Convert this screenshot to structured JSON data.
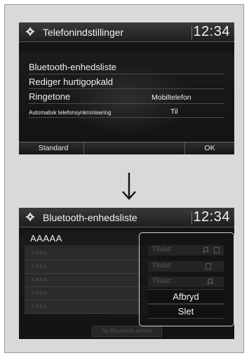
{
  "screen1": {
    "title": "Telefonindstillinger",
    "clock": "12:34",
    "menu": [
      {
        "label": "Bluetooth-enhedsliste",
        "value": ""
      },
      {
        "label": "Rediger hurtigopkald",
        "value": ""
      },
      {
        "label": "Ringetone",
        "value": "Mobiltelefon"
      },
      {
        "label": "Automatisk telefonsynkronisering",
        "value": "Til"
      }
    ],
    "buttons": {
      "left": "Standard",
      "right": "OK"
    }
  },
  "arrow": "↓",
  "screen2": {
    "title": "Bluetooth-enhedsliste",
    "clock": "12:34",
    "devices": [
      "AAAAA",
      "<xxx",
      "<xxx",
      "<xxx",
      "<xxx",
      "<xxx"
    ],
    "bottom_hint": "Ny Bluetooth-enhed",
    "popup": {
      "connect_items": [
        "Tilslut:",
        "Tilslut:",
        "Tilslut:"
      ],
      "actions": [
        "Afbryd",
        "Slet"
      ]
    }
  },
  "colors": {
    "screen_bg": "#141414",
    "frame_bg": "#d9d9d9",
    "text": "#f0f0f0",
    "dim_text": "#555555"
  }
}
